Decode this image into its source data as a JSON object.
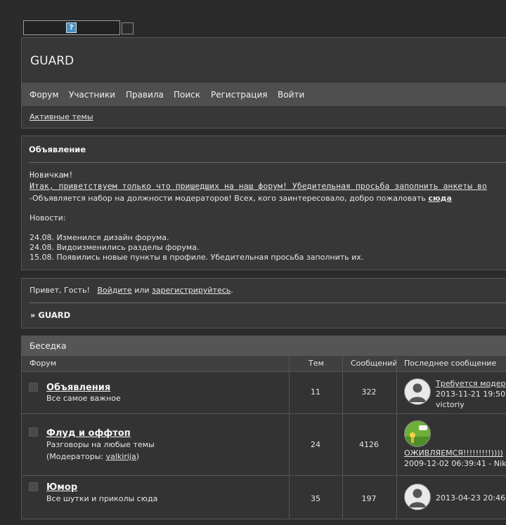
{
  "topbar": {
    "help_glyph": "?"
  },
  "header": {
    "site_title": "GUARD",
    "nav": [
      "Форум",
      "Участники",
      "Правила",
      "Поиск",
      "Регистрация",
      "Войти"
    ],
    "active_topics": "Активные темы"
  },
  "announcement": {
    "title": "Объявление",
    "line1": "Новичкам!",
    "line2": "Итак, приветствуем только что пришедших на наш форум! Убедительная просьба заполнить анкеты во",
    "line3_prefix": "-Объявляется набор на должности модераторов! Всех, кого заинтересовало, добро пожаловать ",
    "line3_link": "сюда",
    "news_label": "Новости:",
    "news": [
      "24.08. Изменился дизайн форума.",
      "24.08. Видоизменились разделы форума.",
      "15.08. Появились новые пункты в профиле. Убедительная просьба заполнить их."
    ]
  },
  "welcome": {
    "greeting": "Привет, Гость!",
    "login_link": "Войдите",
    "or": "или",
    "register_link": "зарегистрируйтесь",
    "dot": ".",
    "breadcrumb": "» GUARD"
  },
  "category": {
    "title": "Беседка",
    "columns": {
      "forum": "Форум",
      "topics": "Тем",
      "posts": "Сообщений",
      "last": "Последнее сообщение"
    },
    "rows": [
      {
        "name": "Объявления",
        "desc": "Все самое важное",
        "topics": "11",
        "posts": "322",
        "last_title": "Требуется модер",
        "last_date": "2013-11-21 19:50",
        "last_author": "victoriy"
      },
      {
        "name": "Флуд и оффтоп",
        "desc": "Разговоры на любые темы",
        "mods_label": "(Модераторы: ",
        "mods_name": "valkirija",
        "mods_close": ")",
        "topics": "24",
        "posts": "4126",
        "last_title": "ОЖИВЛЯЕМСЯ!!!!!!!!!))))",
        "last_date": "2009-12-02 06:39:41 - Nik"
      },
      {
        "name": "Юмор",
        "desc": "Все шутки и приколы сюда",
        "topics": "35",
        "posts": "197",
        "last_date": "2013-04-23 20:46"
      }
    ]
  },
  "icons": {
    "help": "help-icon",
    "forum_status": "forum-status-icon",
    "avatar_default": "default-avatar-icon",
    "avatar_custom": "custom-avatar-icon"
  },
  "colors": {
    "background": "#2b2b2b",
    "panel": "#373737",
    "nav_bar": "#4f4f4f",
    "category_header": "#555555",
    "text": "#e6e6e6"
  }
}
